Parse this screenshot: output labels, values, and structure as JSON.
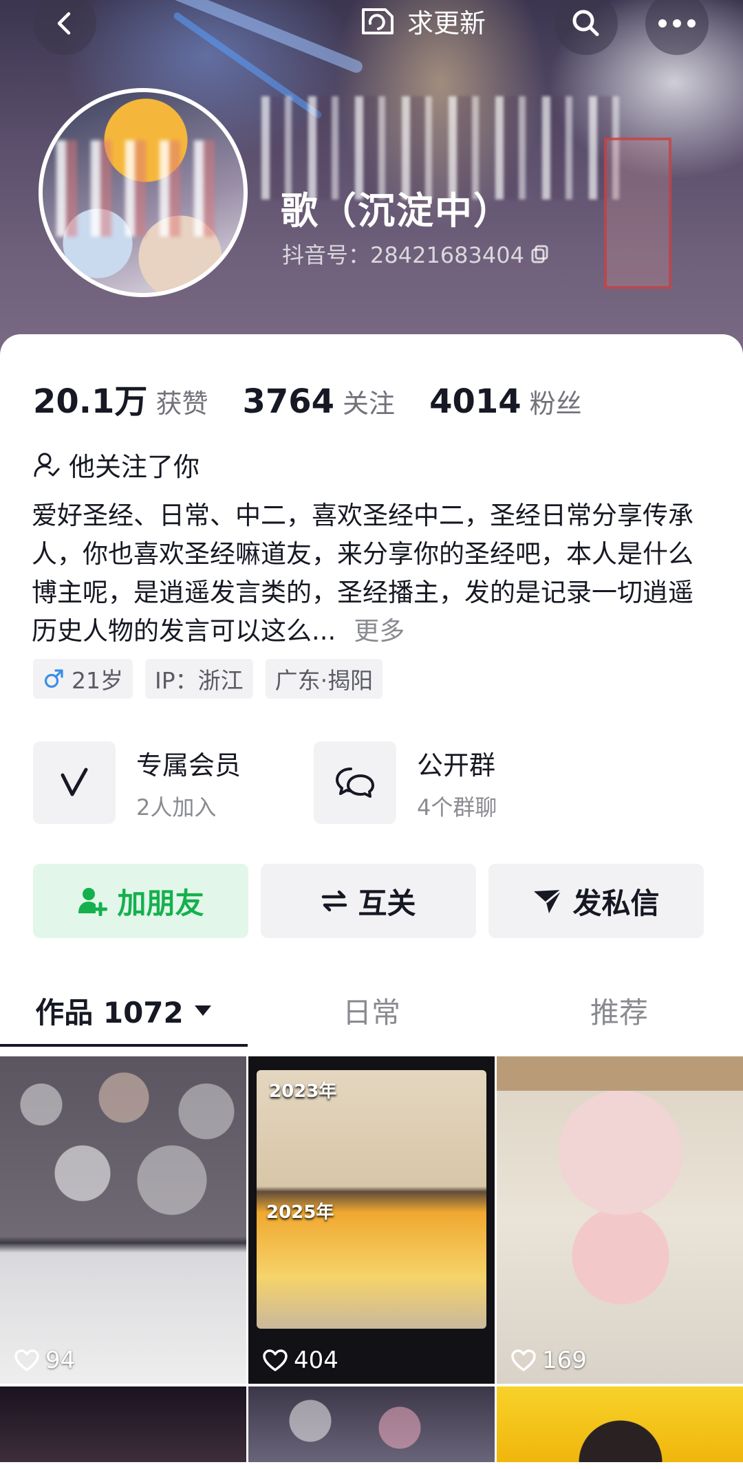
{
  "header": {
    "update_label": "求更新",
    "nickname": "歌（沉淀中）",
    "douyin_id": "抖音号：28421683404"
  },
  "stats": [
    {
      "value": "20.1万",
      "label": "获赞"
    },
    {
      "value": "3764",
      "label": "关注"
    },
    {
      "value": "4014",
      "label": "粉丝"
    }
  ],
  "follow_status": "他关注了你",
  "bio": {
    "text": "爱好圣经、日常、中二，喜欢圣经中二，圣经日常分享传承人，你也喜欢圣经嘛道友，来分享你的圣经吧，本人是什么博主呢，是逍遥发言类的，圣经播主，发的是记录一切逍遥历史人物的发言可以这么...",
    "more_label": "更多"
  },
  "tags": [
    {
      "icon": "male-icon",
      "label": "21岁",
      "icon_color": "#3a8ee6"
    },
    {
      "label": "IP：浙江"
    },
    {
      "label": "广东·揭阳"
    }
  ],
  "features": [
    {
      "icon": "v-icon",
      "title": "专属会员",
      "sub": "2人加入"
    },
    {
      "icon": "chat-icon",
      "title": "公开群",
      "sub": "4个群聊"
    }
  ],
  "actions": {
    "add_friend": "加朋友",
    "mutual": "互关",
    "message": "发私信"
  },
  "tabs": [
    {
      "label": "作品 1072",
      "active": true
    },
    {
      "label": "日常",
      "active": false
    },
    {
      "label": "推荐",
      "active": false
    }
  ],
  "videos": [
    {
      "likes": "94"
    },
    {
      "likes": "404",
      "year_top": "2023年",
      "year_bottom": "2025年"
    },
    {
      "likes": "169"
    }
  ],
  "colors": {
    "green": "#15b04e",
    "green_bg": "#e2f7ea",
    "text": "#161823",
    "secondary": "#8a8b91"
  }
}
